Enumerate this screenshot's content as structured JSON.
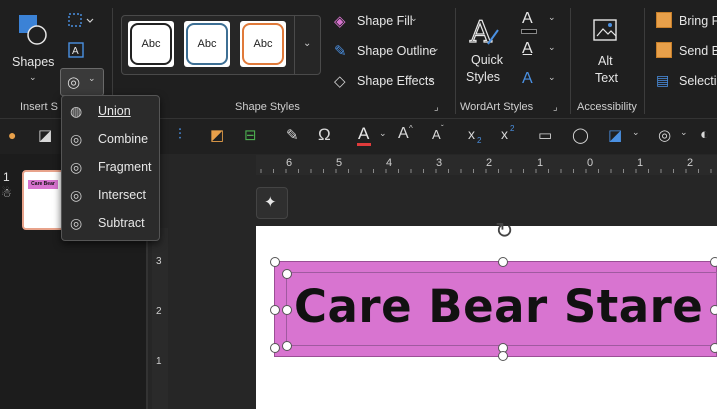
{
  "ribbon": {
    "insert_shapes": {
      "shapes_label": "Shapes",
      "group_label": "Insert S"
    },
    "shape_styles": {
      "group_label": "Shape Styles",
      "tiles": [
        {
          "label": "Abc",
          "border": "#222222"
        },
        {
          "label": "Abc",
          "border": "#3d6f94"
        },
        {
          "label": "Abc",
          "border": "#e07a3a"
        }
      ],
      "fill": "Shape Fill",
      "outline": "Shape Outline",
      "effects": "Shape Effects"
    },
    "wordart": {
      "group_label": "WordArt Styles",
      "quick_styles_line1": "Quick",
      "quick_styles_line2": "Styles",
      "text_fill_glyph": "A"
    },
    "accessibility": {
      "group_label": "Accessibility",
      "alt_text_line1": "Alt",
      "alt_text_line2": "Text"
    },
    "arrange": {
      "bring_forward": "Bring F",
      "send_backward": "Send Ba",
      "selection": "Selectio"
    }
  },
  "merge_menu": {
    "items": [
      {
        "label": "Union"
      },
      {
        "label": "Combine"
      },
      {
        "label": "Fragment"
      },
      {
        "label": "Intersect"
      },
      {
        "label": "Subtract"
      }
    ]
  },
  "toolbar": {
    "font_color_glyph": "A",
    "grow_font": "A",
    "shrink_font": "A",
    "subscript": "x",
    "superscript": "x"
  },
  "sidebar": {
    "slide_number": "1",
    "thumb_text": "Care Bear"
  },
  "ruler": {
    "h_numbers": [
      "6",
      "5",
      "4",
      "3",
      "2",
      "1",
      "0",
      "1",
      "2"
    ],
    "v_numbers": [
      "3",
      "2",
      "1"
    ]
  },
  "slide": {
    "title": "Care Bear Stare"
  },
  "colors": {
    "accent_pink": "#d874d0",
    "font_red": "#e03b3b"
  }
}
